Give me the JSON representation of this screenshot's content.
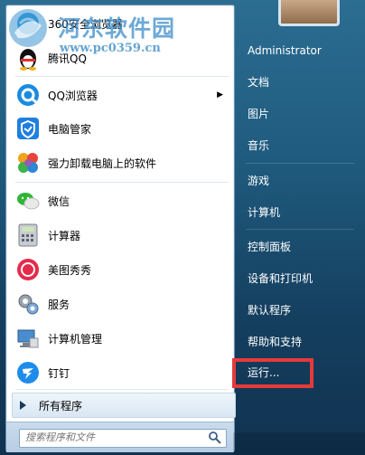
{
  "programs": [
    {
      "label": "360安全浏览器",
      "icon": "360-browser-icon"
    },
    {
      "label": "腾讯QQ",
      "icon": "qq-penguin-icon"
    },
    {
      "label": "QQ浏览器",
      "icon": "qq-browser-icon",
      "has_submenu": true
    },
    {
      "label": "电脑管家",
      "icon": "pc-manager-shield-icon"
    },
    {
      "label": "强力卸载电脑上的软件",
      "icon": "uninstaller-icon"
    },
    {
      "label": "微信",
      "icon": "wechat-icon"
    },
    {
      "label": "计算器",
      "icon": "calculator-icon"
    },
    {
      "label": "美图秀秀",
      "icon": "meitu-icon"
    },
    {
      "label": "服务",
      "icon": "services-gear-icon"
    },
    {
      "label": "计算机管理",
      "icon": "computer-management-icon"
    },
    {
      "label": "钉钉",
      "icon": "dingtalk-icon"
    }
  ],
  "submenu_arrow": "▶",
  "all_programs": {
    "label": "所有程序"
  },
  "search": {
    "placeholder": "搜索程序和文件"
  },
  "right_menu": [
    {
      "label": "Administrator"
    },
    {
      "label": "文档"
    },
    {
      "label": "图片"
    },
    {
      "label": "音乐"
    },
    {
      "label": "游戏"
    },
    {
      "label": "计算机"
    },
    {
      "label": "控制面板"
    },
    {
      "label": "设备和打印机"
    },
    {
      "label": "默认程序"
    },
    {
      "label": "帮助和支持"
    },
    {
      "label": "运行..."
    }
  ],
  "watermark": {
    "title": "河东软件园",
    "url": "www.pc0359.cn"
  },
  "colors": {
    "highlight": "#e53a3a",
    "accent": "#1f5b7e"
  }
}
